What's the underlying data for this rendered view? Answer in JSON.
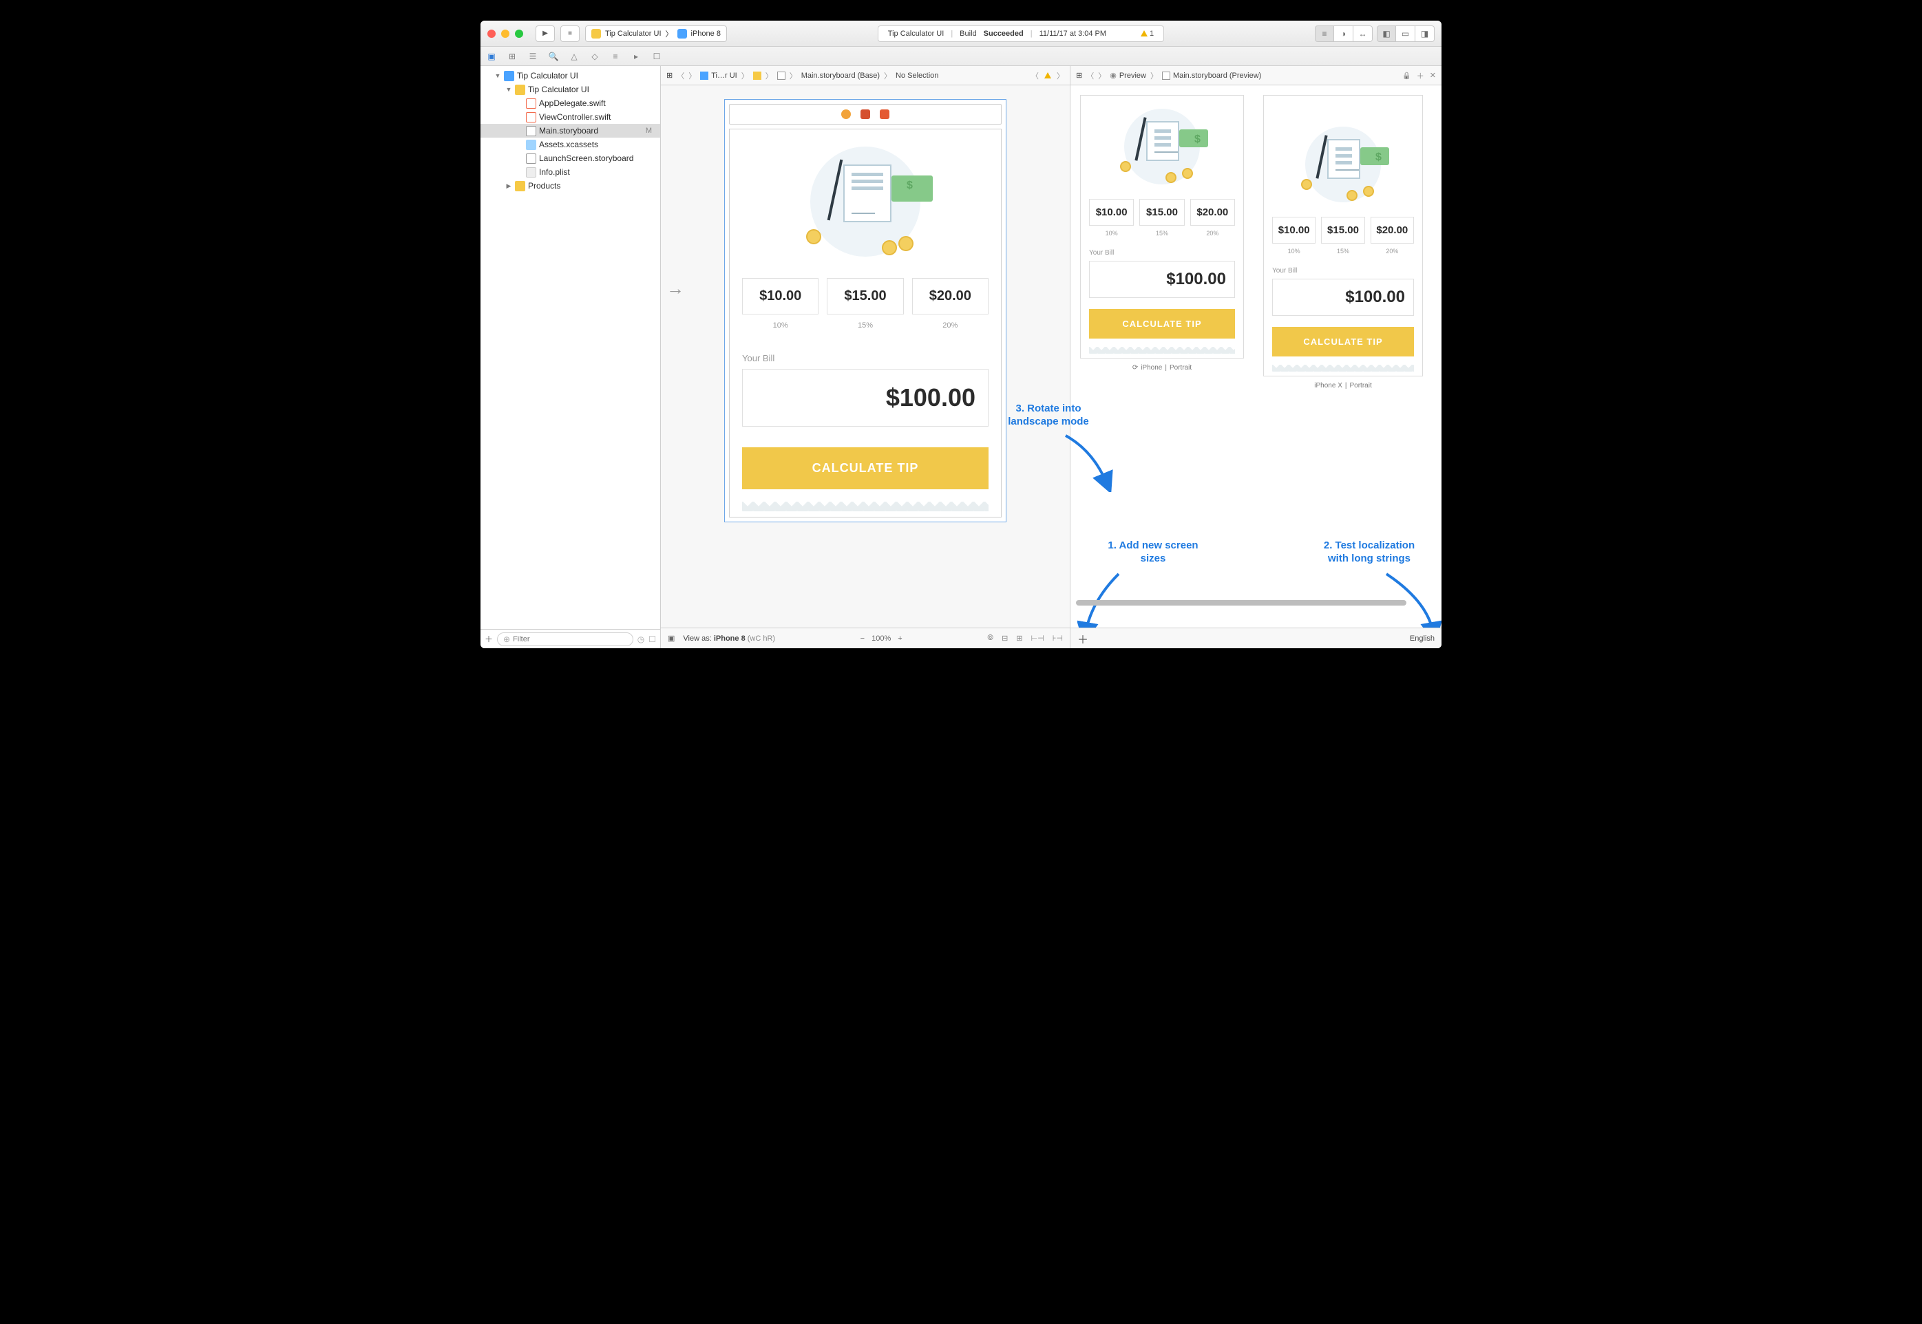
{
  "titlebar": {
    "scheme_app": "Tip Calculator UI",
    "scheme_device": "iPhone 8",
    "status_project": "Tip Calculator UI",
    "status_build_prefix": "Build",
    "status_build_result": "Succeeded",
    "status_time": "11/11/17 at 3:04 PM",
    "warning_count": "1"
  },
  "navigator": {
    "project": "Tip Calculator UI",
    "group": "Tip Calculator UI",
    "files": [
      {
        "name": "AppDelegate.swift",
        "kind": "swift"
      },
      {
        "name": "ViewController.swift",
        "kind": "swift"
      },
      {
        "name": "Main.storyboard",
        "kind": "sb",
        "modified": "M",
        "selected": true
      },
      {
        "name": "Assets.xcassets",
        "kind": "assets"
      },
      {
        "name": "LaunchScreen.storyboard",
        "kind": "sb"
      },
      {
        "name": "Info.plist",
        "kind": "plist"
      }
    ],
    "products": "Products",
    "filter_placeholder": "Filter"
  },
  "jumpbar": {
    "crumbs": [
      "Ti…r UI",
      "",
      "",
      "Main.storyboard (Base)",
      "No Selection"
    ]
  },
  "jumpbar_preview": {
    "crumbs": [
      "Preview",
      "Main.storyboard (Preview)"
    ]
  },
  "app": {
    "tips": [
      "$10.00",
      "$15.00",
      "$20.00"
    ],
    "pcts": [
      "10%",
      "15%",
      "20%"
    ],
    "bill_label": "Your Bill",
    "bill_value": "$100.00",
    "calculate": "CALCULATE TIP"
  },
  "preview": {
    "device1": "iPhone",
    "device1_orientation": "Portrait",
    "device2": "iPhone X",
    "device2_orientation": "Portrait",
    "language": "English"
  },
  "editor_bottom": {
    "view_as_prefix": "View as:",
    "view_as_device": "iPhone 8",
    "size_class": "(wC hR)",
    "zoom": "100%"
  },
  "annotations": {
    "a1": "1. Add new screen\nsizes",
    "a2": "2. Test localization\nwith long strings",
    "a3": "3. Rotate into\nlandscape mode"
  }
}
